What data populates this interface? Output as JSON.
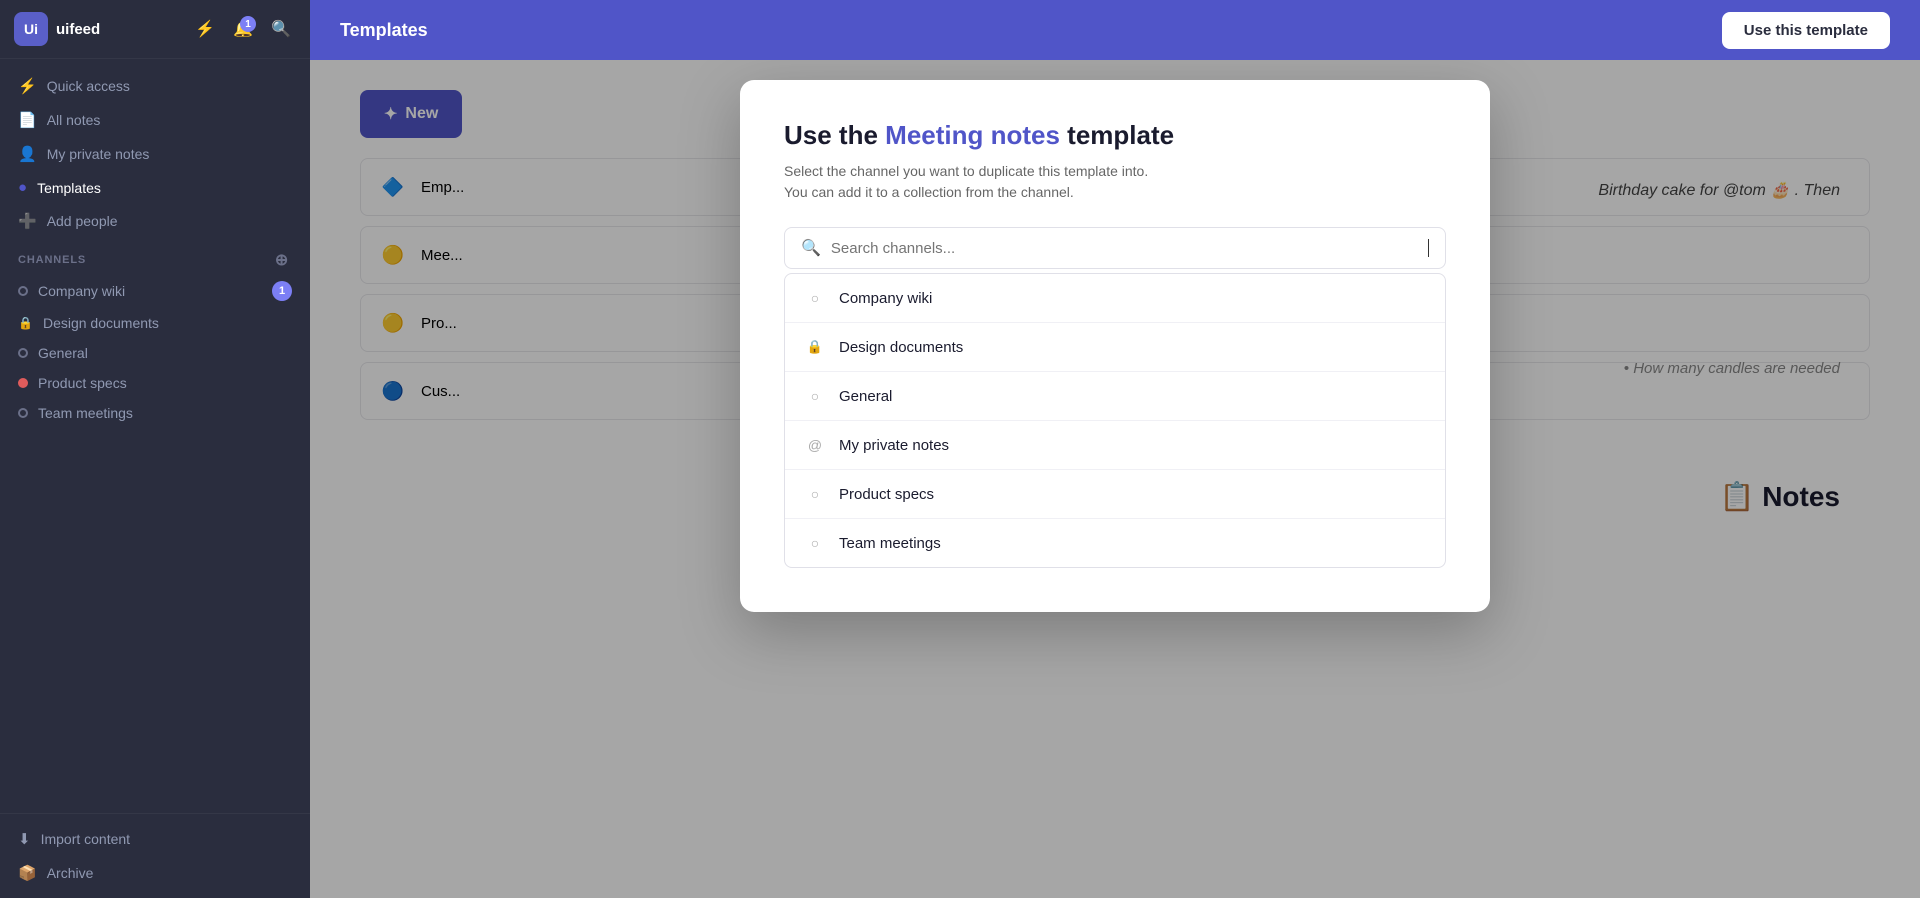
{
  "sidebar": {
    "workspace_name": "uifeed",
    "avatar_initials": "Ui",
    "notification_count": "1",
    "nav_items": [
      {
        "id": "quick-access",
        "label": "Quick access",
        "icon": "⚡"
      },
      {
        "id": "all-notes",
        "label": "All notes",
        "icon": "📄"
      },
      {
        "id": "my-private-notes",
        "label": "My private notes",
        "icon": "👤"
      },
      {
        "id": "templates",
        "label": "Templates",
        "icon": "🔵"
      },
      {
        "id": "add-people",
        "label": "Add people",
        "icon": "➕"
      }
    ],
    "channels_header": "CHANNELS",
    "channels": [
      {
        "id": "company-wiki",
        "label": "Company wiki",
        "dot_type": "empty",
        "badge": "1"
      },
      {
        "id": "design-documents",
        "label": "Design documents",
        "dot_type": "lock"
      },
      {
        "id": "general",
        "label": "General",
        "dot_type": "empty"
      },
      {
        "id": "product-specs",
        "label": "Product specs",
        "dot_type": "red"
      },
      {
        "id": "team-meetings",
        "label": "Team meetings",
        "dot_type": "empty"
      }
    ],
    "bottom_items": [
      {
        "id": "import-content",
        "label": "Import content",
        "icon": "⬇"
      },
      {
        "id": "archive",
        "label": "Archive",
        "icon": "📦"
      }
    ]
  },
  "header": {
    "title": "Templates",
    "use_template_label": "Use this template"
  },
  "page_bg": {
    "new_button_label": "New",
    "template_items": [
      {
        "id": "employee",
        "label": "Employee...",
        "icon": "🔷"
      },
      {
        "id": "meeting",
        "label": "Mee...",
        "icon": "🟡"
      },
      {
        "id": "product",
        "label": "Pro...",
        "icon": "🟡"
      },
      {
        "id": "customer",
        "label": "Cus...",
        "icon": "🔵"
      }
    ],
    "content_text": "Birthday cake for @tom 🎂 . Then",
    "bullet_text": "How many candles are needed",
    "notes_heading": "Notes"
  },
  "modal": {
    "title_prefix": "Use the ",
    "title_highlight": "Meeting notes",
    "title_suffix": " template",
    "subtitle_line1": "Select the channel you want to duplicate this template into.",
    "subtitle_line2": "You can add it to a collection from the channel.",
    "search_placeholder": "Search channels...",
    "channels": [
      {
        "id": "company-wiki",
        "label": "Company wiki",
        "icon_type": "circle"
      },
      {
        "id": "design-documents",
        "label": "Design documents",
        "icon_type": "lock"
      },
      {
        "id": "general",
        "label": "General",
        "icon_type": "circle"
      },
      {
        "id": "my-private-notes",
        "label": "My private notes",
        "icon_type": "at"
      },
      {
        "id": "product-specs",
        "label": "Product specs",
        "icon_type": "circle"
      },
      {
        "id": "team-meetings",
        "label": "Team meetings",
        "icon_type": "circle"
      }
    ]
  }
}
